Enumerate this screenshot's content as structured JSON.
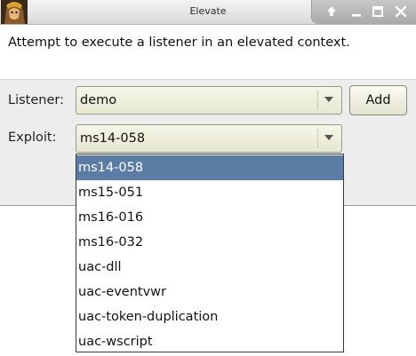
{
  "window": {
    "title": "Elevate",
    "icon": "app-avatar-icon",
    "controls": [
      "restore-up-icon",
      "minimize-icon",
      "maximize-icon",
      "close-icon"
    ]
  },
  "description": "Attempt to execute a listener in an elevated context.",
  "form": {
    "listener_label": "Listener:",
    "listener_value": "demo",
    "add_label": "Add",
    "exploit_label": "Exploit:",
    "exploit_value": "ms14-058"
  },
  "exploit_options": [
    "ms14-058",
    "ms15-051",
    "ms16-016",
    "ms16-032",
    "uac-dll",
    "uac-eventvwr",
    "uac-token-duplication",
    "uac-wscript"
  ],
  "colors": {
    "selection": "#5b7ca5",
    "combo_bg": "#e6e8cf"
  }
}
